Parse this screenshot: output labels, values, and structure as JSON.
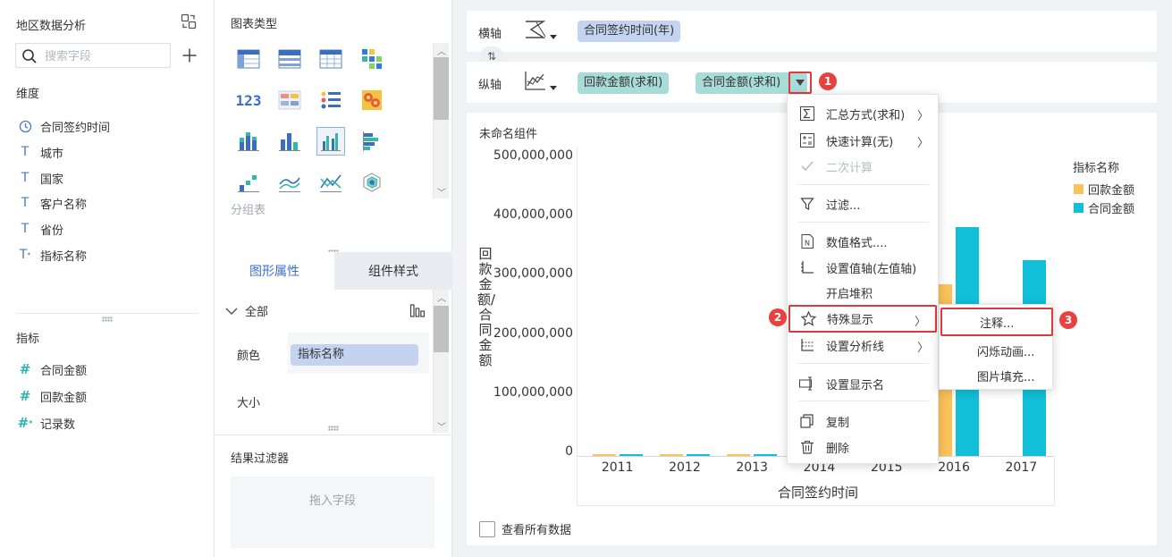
{
  "left_panel": {
    "dataset_title": "地区数据分析",
    "search_placeholder": "搜索字段",
    "dimensions_label": "维度",
    "dimensions": [
      "合同签约时间",
      "城市",
      "国家",
      "客户名称",
      "省份",
      "指标名称"
    ],
    "measures_label": "指标",
    "measures": [
      "合同金额",
      "回款金额",
      "记录数"
    ]
  },
  "middle_panel": {
    "chart_type_title": "图表类型",
    "group_table_label": "分组表",
    "tabs": [
      "图形属性",
      "组件样式"
    ],
    "all_label": "全部",
    "color_label": "颜色",
    "color_field": "指标名称",
    "size_label": "大小",
    "result_filter_title": "结果过滤器",
    "drop_field_hint": "拖入字段"
  },
  "axes": {
    "x_label": "横轴",
    "x_field": "合同签约时间(年)",
    "y_label": "纵轴",
    "y_fields": [
      "回款金额(求和)",
      "合同金额(求和)"
    ]
  },
  "chart": {
    "widget_title": "未命名组件",
    "view_all_data": "查看所有数据",
    "colors": {
      "回款金额": "#fbc25a",
      "合同金额": "#12bfd9"
    }
  },
  "chart_data": {
    "type": "bar",
    "categories": [
      "2011",
      "2012",
      "2013",
      "2014",
      "2015",
      "2016",
      "2017"
    ],
    "series": [
      {
        "name": "回款金额",
        "values": [
          1500000,
          1500000,
          2000000,
          null,
          null,
          290000000,
          null
        ]
      },
      {
        "name": "合同金额",
        "values": [
          1500000,
          1500000,
          3000000,
          null,
          null,
          387000000,
          331000000
        ]
      }
    ],
    "ylim": [
      0,
      500000000
    ],
    "yticks": [
      "0",
      "100,000,000",
      "200,000,000",
      "300,000,000",
      "400,000,000",
      "500,000,000"
    ],
    "xlabel": "合同签约时间",
    "ylabel": "回款金额/合同金额",
    "legend_title": "指标名称",
    "legend": [
      "回款金额",
      "合同金额"
    ],
    "legend_position": "right"
  },
  "context_menu": {
    "items": [
      {
        "label": "汇总方式(求和)",
        "icon": "sigma-icon",
        "submenu": true
      },
      {
        "label": "快速计算(无)",
        "icon": "calc-icon",
        "submenu": true
      },
      {
        "label": "二次计算",
        "icon": "check-icon",
        "disabled": true
      },
      {
        "label": "过滤...",
        "icon": "filter-icon"
      },
      {
        "label": "数值格式....",
        "icon": "number-format-icon"
      },
      {
        "label": "设置值轴(左值轴)",
        "icon": "axis-icon"
      },
      {
        "label": "开启堆积",
        "icon": ""
      },
      {
        "label": "特殊显示",
        "icon": "star-icon",
        "submenu": true
      },
      {
        "label": "设置分析线",
        "icon": "analysis-line-icon",
        "submenu": true
      },
      {
        "label": "设置显示名",
        "icon": "rename-icon"
      },
      {
        "label": "复制",
        "icon": "copy-icon"
      },
      {
        "label": "删除",
        "icon": "trash-icon"
      }
    ]
  },
  "sub_menu": {
    "items": [
      "注释...",
      "闪烁动画...",
      "图片填充..."
    ]
  },
  "badges": [
    "1",
    "2",
    "3"
  ]
}
